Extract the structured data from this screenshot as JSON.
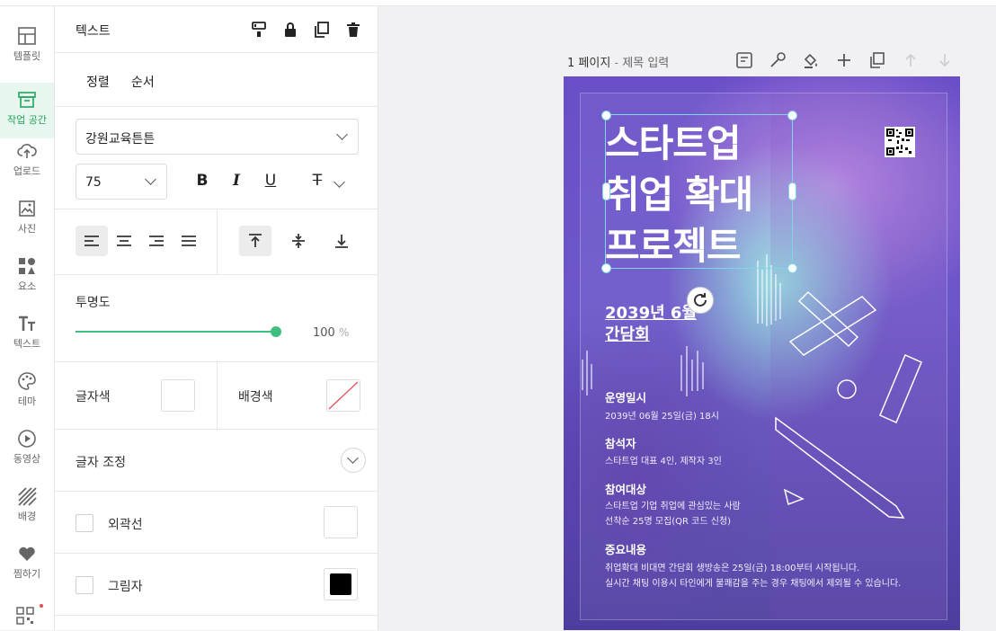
{
  "sidebar": {
    "items": [
      {
        "label": "템플릿",
        "icon": "template-icon"
      },
      {
        "label": "작업 공간",
        "icon": "workspace-icon",
        "active": true
      },
      {
        "label": "업로드",
        "icon": "upload-icon"
      },
      {
        "label": "사진",
        "icon": "photo-icon"
      },
      {
        "label": "요소",
        "icon": "elements-icon"
      },
      {
        "label": "텍스트",
        "icon": "text-icon"
      },
      {
        "label": "테마",
        "icon": "palette-icon"
      },
      {
        "label": "동영상",
        "icon": "video-icon"
      },
      {
        "label": "배경",
        "icon": "background-icon"
      },
      {
        "label": "찜하기",
        "icon": "heart-icon"
      }
    ]
  },
  "panel": {
    "title": "텍스트",
    "tabs": {
      "align": "정렬",
      "order": "순서"
    },
    "font": {
      "family": "강원교육튼튼",
      "size": "75"
    },
    "opacity": {
      "label": "투명도",
      "value": "100",
      "unit": "%",
      "level": 1.0
    },
    "colors": {
      "text_label": "글자색",
      "bg_label": "배경색",
      "text_color": "#ffffff"
    },
    "adjust_label": "글자 조정",
    "outline_label": "외곽선",
    "shadow_label": "그림자",
    "shadow_color": "#000000"
  },
  "page": {
    "number": "1 페이지",
    "separator": " - ",
    "title_placeholder": "제목 입력"
  },
  "poster": {
    "title_lines": [
      "스타트업",
      "취업 확대",
      "프로젝트"
    ],
    "subtitle_lines": [
      "2039년 6월",
      "간담회"
    ],
    "blocks": [
      {
        "heading": "운영일시",
        "lines": [
          "2039년 06월 25일(금) 18시"
        ]
      },
      {
        "heading": "참석자",
        "lines": [
          "스타트업 대표 4인, 제작자 3인"
        ]
      },
      {
        "heading": "참여대상",
        "lines": [
          "스타트업 기업 취업에 관심있는 사람",
          "선착순 25명 모집(QR 코드 신청)"
        ]
      },
      {
        "heading": "중요내용",
        "lines": [
          "취업확대 비대면 간담회 생방송은 25일(금) 18:00부터 시작됩니다.",
          "실시간 채팅 이용시 타인에게 불쾌감을 주는 경우 채팅에서 제외될 수 있습니다."
        ]
      }
    ]
  },
  "colors": {
    "accent": "#25a35d",
    "slider": "#3fbf7f",
    "selection": "#7fd6e6"
  }
}
